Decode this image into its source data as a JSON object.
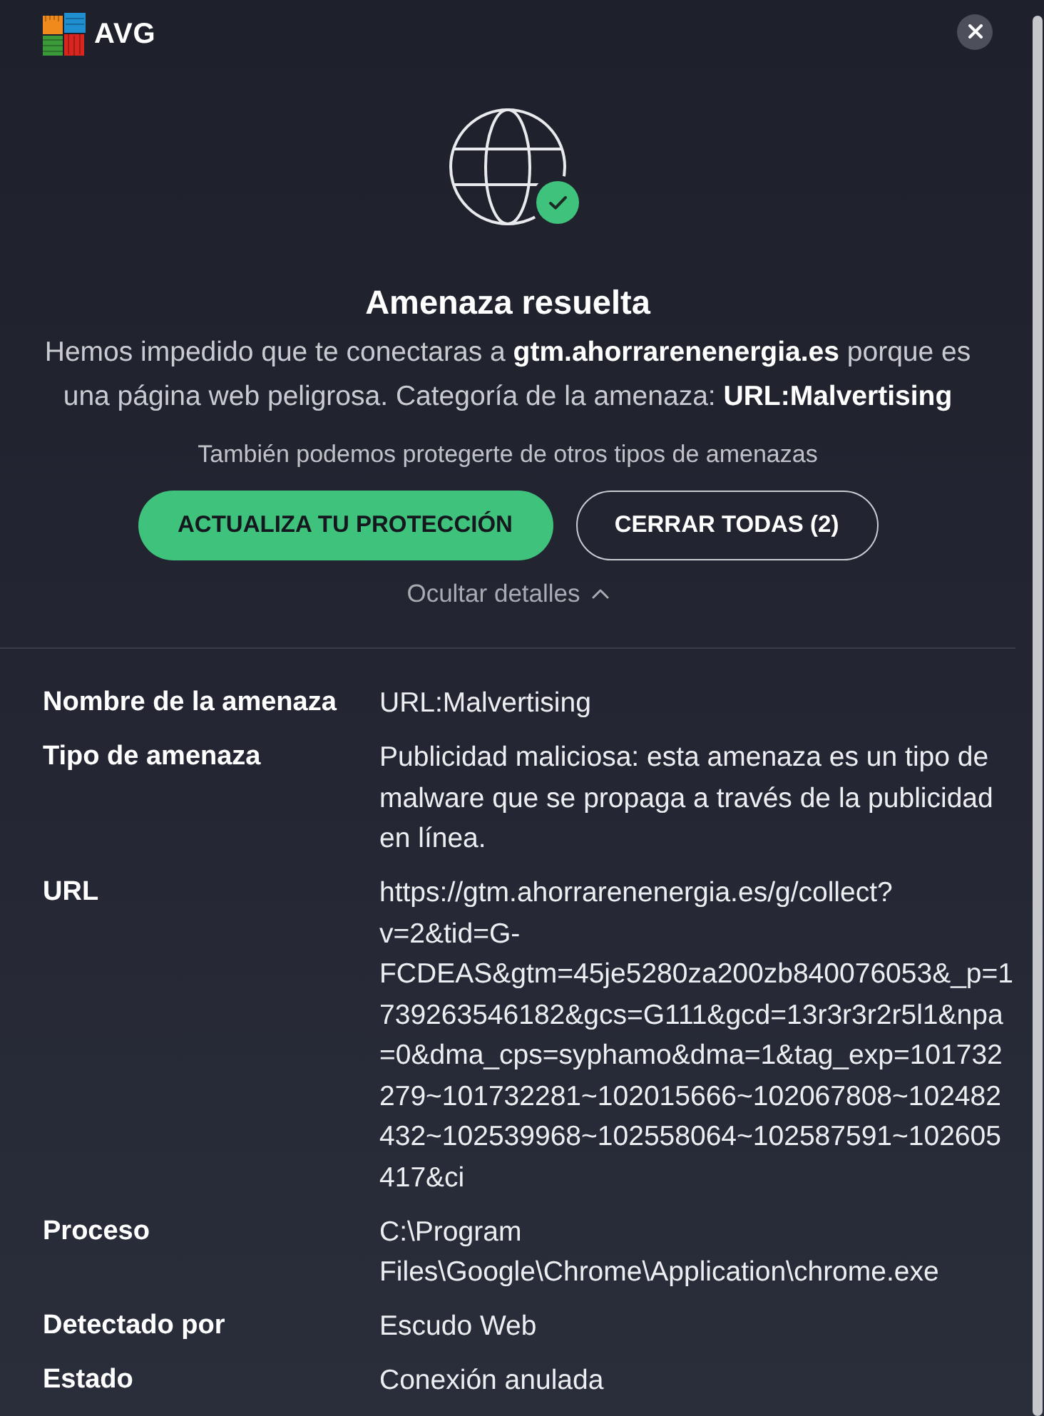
{
  "header": {
    "logo_text": "AVG"
  },
  "alert": {
    "title": "Amenaza resuelta",
    "message": "Hemos impedido que te conectaras a **gtm.ahorrarenenergia.es** porque es una página web peligrosa. Categoría de la amenaza: **URL:Malvertising**",
    "note": "También podemos protegerte de otros tipos de amenazas",
    "buttons": [
      {
        "label": "ACTUALIZA TU PROTECCIÓN",
        "kind": "primary"
      },
      {
        "label": "CERRAR TODAS (2)",
        "kind": "secondary"
      }
    ],
    "details_toggle": {
      "label": "Ocultar detalles",
      "expanded": true
    }
  },
  "details": [
    {
      "label": "Nombre de la amenaza",
      "value": "URL:Malvertising"
    },
    {
      "label": "Tipo de amenaza",
      "value": "Publicidad maliciosa: esta amenaza es un tipo de malware que se propaga a través de la publicidad en línea."
    },
    {
      "label": "URL",
      "value": "https://gtm.ahorrarenenergia.es/g/collect?v=2&tid=G-FCDEAS&gtm=45je5280za200zb840076053&_p=1739263546182&gcs=G111&gcd=13r3r3r2r5l1&npa=0&dma_cps=syphamo&dma=1&tag_exp=101732279~101732281~102015666~102067808~102482432~102539968~102558064~102587591~102605417&ci"
    },
    {
      "label": "Proceso",
      "value": "C:\\Program Files\\Google\\Chrome\\Application\\chrome.exe"
    },
    {
      "label": "Detectado por",
      "value": "Escudo Web"
    },
    {
      "label": "Estado",
      "value": "Conexión anulada"
    }
  ]
}
